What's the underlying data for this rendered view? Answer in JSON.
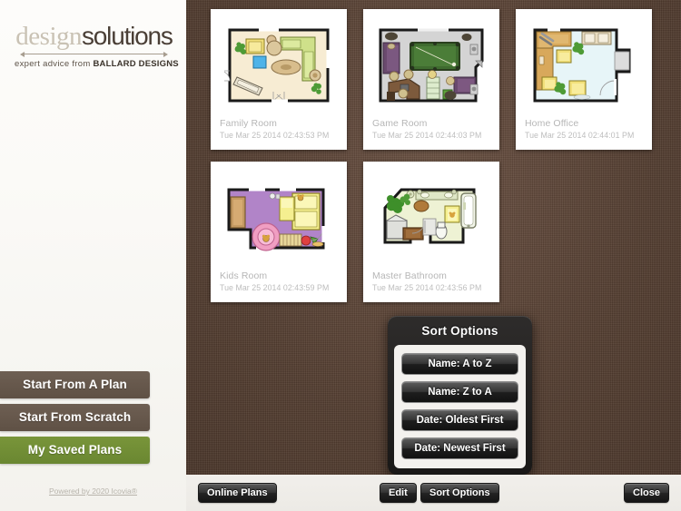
{
  "sidebar": {
    "logo": {
      "word1": "design",
      "word2": "solutions",
      "tagline_prefix": "expert advice from ",
      "tagline_brand": "BALLARD DESIGNS"
    },
    "buttons": [
      {
        "label": "Start From A Plan",
        "style": "brown"
      },
      {
        "label": "Start From Scratch",
        "style": "brown"
      },
      {
        "label": "My Saved Plans",
        "style": "green"
      }
    ],
    "footer_link": "Powered by 2020 Icovia®"
  },
  "plans": [
    {
      "title": "Family Room",
      "date": "Tue Mar 25 2014 02:43:53 PM"
    },
    {
      "title": "Game Room",
      "date": "Tue Mar 25 2014 02:44:03 PM"
    },
    {
      "title": "Home Office",
      "date": "Tue Mar 25 2014 02:44:01 PM"
    },
    {
      "title": "Kids Room",
      "date": "Tue Mar 25 2014 02:43:59 PM"
    },
    {
      "title": "Master Bathroom",
      "date": "Tue Mar 25 2014 02:43:56 PM"
    }
  ],
  "popover": {
    "title": "Sort Options",
    "options": [
      "Name: A to Z",
      "Name: Z to A",
      "Date: Oldest First",
      "Date: Newest First"
    ]
  },
  "toolbar": {
    "online_plans": "Online Plans",
    "edit": "Edit",
    "sort_options": "Sort Options",
    "close": "Close"
  },
  "colors": {
    "accent_green": "#6f8c33",
    "accent_brown": "#64554a",
    "canvas_bg": "#5b4436",
    "card_bg": "#ffffff",
    "card_text": "#b8b8b8"
  }
}
